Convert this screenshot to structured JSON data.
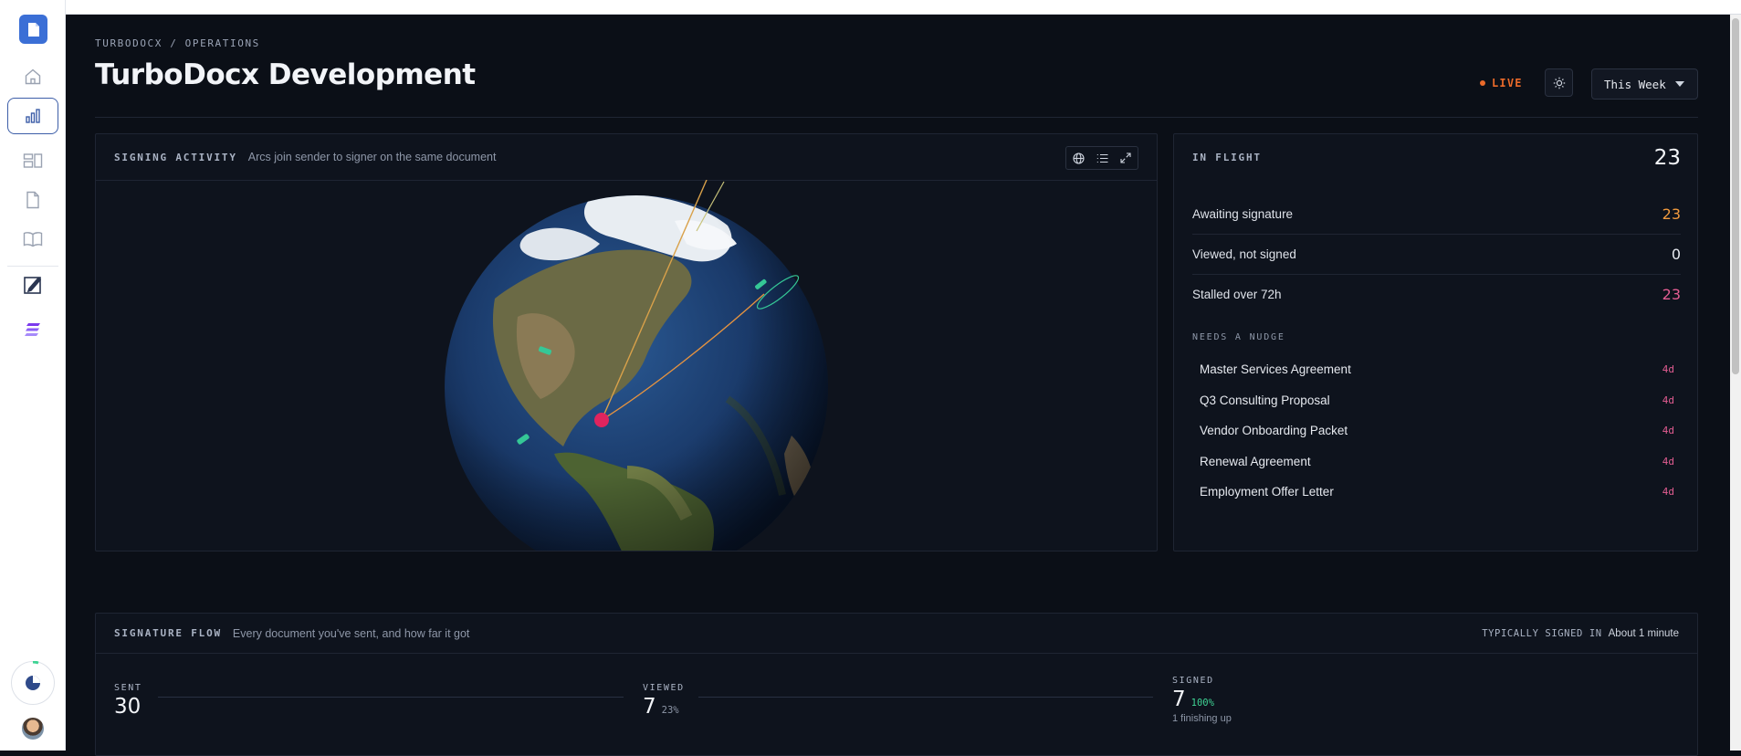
{
  "breadcrumb": "TURBODOCX / OPERATIONS",
  "page_title": "TurboDocx Development",
  "live_label": "LIVE",
  "range_selector": {
    "value": "This Week"
  },
  "colors": {
    "accent": "#3b6fd6",
    "live": "#ea6a2a",
    "awaiting": "#f19a3e",
    "stalled": "#e35d92",
    "success": "#3fd394"
  },
  "sidebar": {
    "items": [
      {
        "name": "home-icon",
        "active": false
      },
      {
        "name": "analytics-icon",
        "active": true
      },
      {
        "name": "layout-icon",
        "active": false
      },
      {
        "name": "document-icon",
        "active": false
      },
      {
        "name": "book-icon",
        "active": false
      },
      {
        "name": "sign-document-icon",
        "active": false
      },
      {
        "name": "stack-logo-icon",
        "active": false
      }
    ]
  },
  "signing_activity": {
    "label": "SIGNING ACTIVITY",
    "subtitle": "Arcs join sender to signer on the same document",
    "tools": [
      "globe-icon",
      "list-icon",
      "expand-icon"
    ]
  },
  "in_flight": {
    "label": "IN FLIGHT",
    "total": "23",
    "stats": [
      {
        "label": "Awaiting signature",
        "value": "23",
        "color": "#f19a3e"
      },
      {
        "label": "Viewed, not signed",
        "value": "0",
        "color": "#e6e9ef"
      },
      {
        "label": "Stalled over 72h",
        "value": "23",
        "color": "#e35d92"
      }
    ],
    "nudge_label": "NEEDS A NUDGE",
    "nudges": [
      {
        "title": "Master Services Agreement",
        "age": "4d"
      },
      {
        "title": "Q3 Consulting Proposal",
        "age": "4d"
      },
      {
        "title": "Vendor Onboarding Packet",
        "age": "4d"
      },
      {
        "title": "Renewal Agreement",
        "age": "4d"
      },
      {
        "title": "Employment Offer Letter",
        "age": "4d"
      }
    ]
  },
  "signature_flow": {
    "label": "SIGNATURE FLOW",
    "subtitle": "Every document you've sent, and how far it got",
    "typical_label": "TYPICALLY SIGNED IN",
    "typical_value": "About 1 minute",
    "stages": [
      {
        "label": "SENT",
        "value": "30",
        "pct": ""
      },
      {
        "label": "VIEWED",
        "value": "7",
        "pct": "23%"
      },
      {
        "label": "SIGNED",
        "value": "7",
        "pct": "100%",
        "note": "1 finishing up"
      }
    ]
  }
}
